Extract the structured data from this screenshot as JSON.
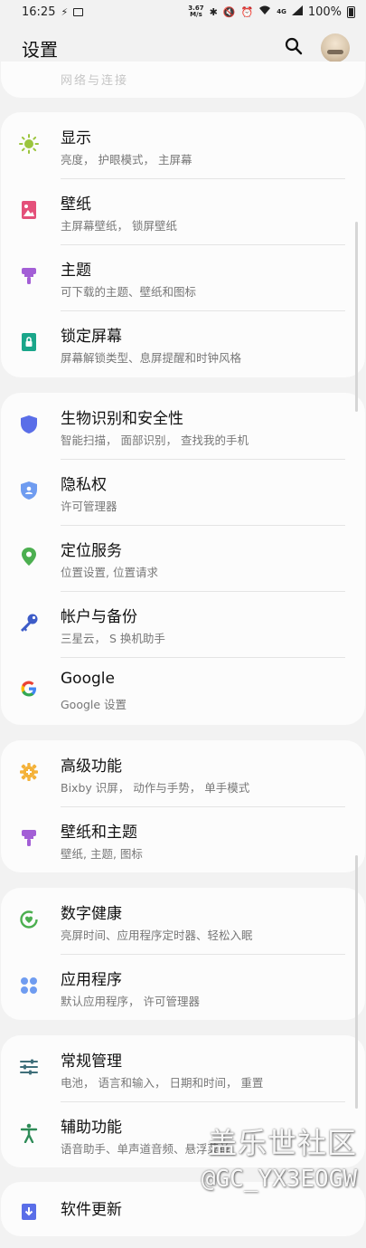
{
  "status_bar": {
    "time": "16:25",
    "net_speed_value": "3.67",
    "net_speed_unit": "M/s",
    "battery": "100%",
    "icons": [
      "notification-icon",
      "image-icon",
      "bluetooth-icon",
      "mute-icon",
      "alarm-icon",
      "wifi-icon",
      "lte-signal-icon",
      "signal-icon",
      "battery-icon"
    ]
  },
  "header": {
    "title": "设置",
    "search_icon": "search-icon",
    "avatar": "profile-avatar"
  },
  "partial_top": {
    "label": "网络与连接"
  },
  "groups": [
    {
      "items": [
        {
          "title": "显示",
          "subtitle": "亮度， 护眼模式， 主屏幕",
          "icon": "sun-icon",
          "color": "#9bc53d"
        },
        {
          "title": "壁纸",
          "subtitle": "主屏幕壁纸， 锁屏壁纸",
          "icon": "image-icon",
          "color": "#e4507a"
        },
        {
          "title": "主题",
          "subtitle": "可下载的主题、壁纸和图标",
          "icon": "paintbrush-icon",
          "color": "#a35fd6"
        },
        {
          "title": "锁定屏幕",
          "subtitle": "屏幕解锁类型、息屏提醒和时钟风格",
          "icon": "lock-screen-icon",
          "color": "#1aa68a"
        }
      ]
    },
    {
      "items": [
        {
          "title": "生物识别和安全性",
          "subtitle": "智能扫描， 面部识别， 查找我的手机",
          "icon": "shield-icon",
          "color": "#5a6ee8"
        },
        {
          "title": "隐私权",
          "subtitle": "许可管理器",
          "icon": "privacy-shield-icon",
          "color": "#5a8ee8"
        },
        {
          "title": "定位服务",
          "subtitle": "位置设置, 位置请求",
          "icon": "location-pin-icon",
          "color": "#4caf50"
        },
        {
          "title": "帐户与备份",
          "subtitle": "三星云， S 换机助手",
          "icon": "key-icon",
          "color": "#3d5cc8"
        },
        {
          "title": "Google",
          "subtitle": "Google 设置",
          "icon": "google-icon",
          "color": "#4285f4"
        }
      ]
    },
    {
      "items": [
        {
          "title": "高级功能",
          "subtitle": "Bixby 识屏， 动作与手势， 单手模式",
          "icon": "gear-plus-icon",
          "color": "#f4b23a"
        },
        {
          "title": "壁纸和主题",
          "subtitle": "壁纸, 主题, 图标",
          "icon": "paintbrush-icon",
          "color": "#a35fd6"
        }
      ]
    },
    {
      "items": [
        {
          "title": "数字健康",
          "subtitle": "亮屏时间、应用程序定时器、轻松入眠",
          "icon": "digital-wellbeing-icon",
          "color": "#4caf50"
        },
        {
          "title": "应用程序",
          "subtitle": "默认应用程序， 许可管理器",
          "icon": "apps-grid-icon",
          "color": "#5a8ee8"
        }
      ]
    },
    {
      "items": [
        {
          "title": "常规管理",
          "subtitle": "电池， 语言和输入， 日期和时间， 重置",
          "icon": "sliders-icon",
          "color": "#3f6f7a"
        },
        {
          "title": "辅助功能",
          "subtitle": "语音助手、单声道音频、悬浮菜单",
          "icon": "accessibility-icon",
          "color": "#2e8b57"
        }
      ]
    },
    {
      "items": [
        {
          "title": "软件更新",
          "subtitle": "",
          "icon": "software-update-icon",
          "color": "#5a6ee8"
        }
      ]
    }
  ],
  "watermark": {
    "line1": "盖乐世社区",
    "line2": "@GC_YX3EOGW"
  }
}
